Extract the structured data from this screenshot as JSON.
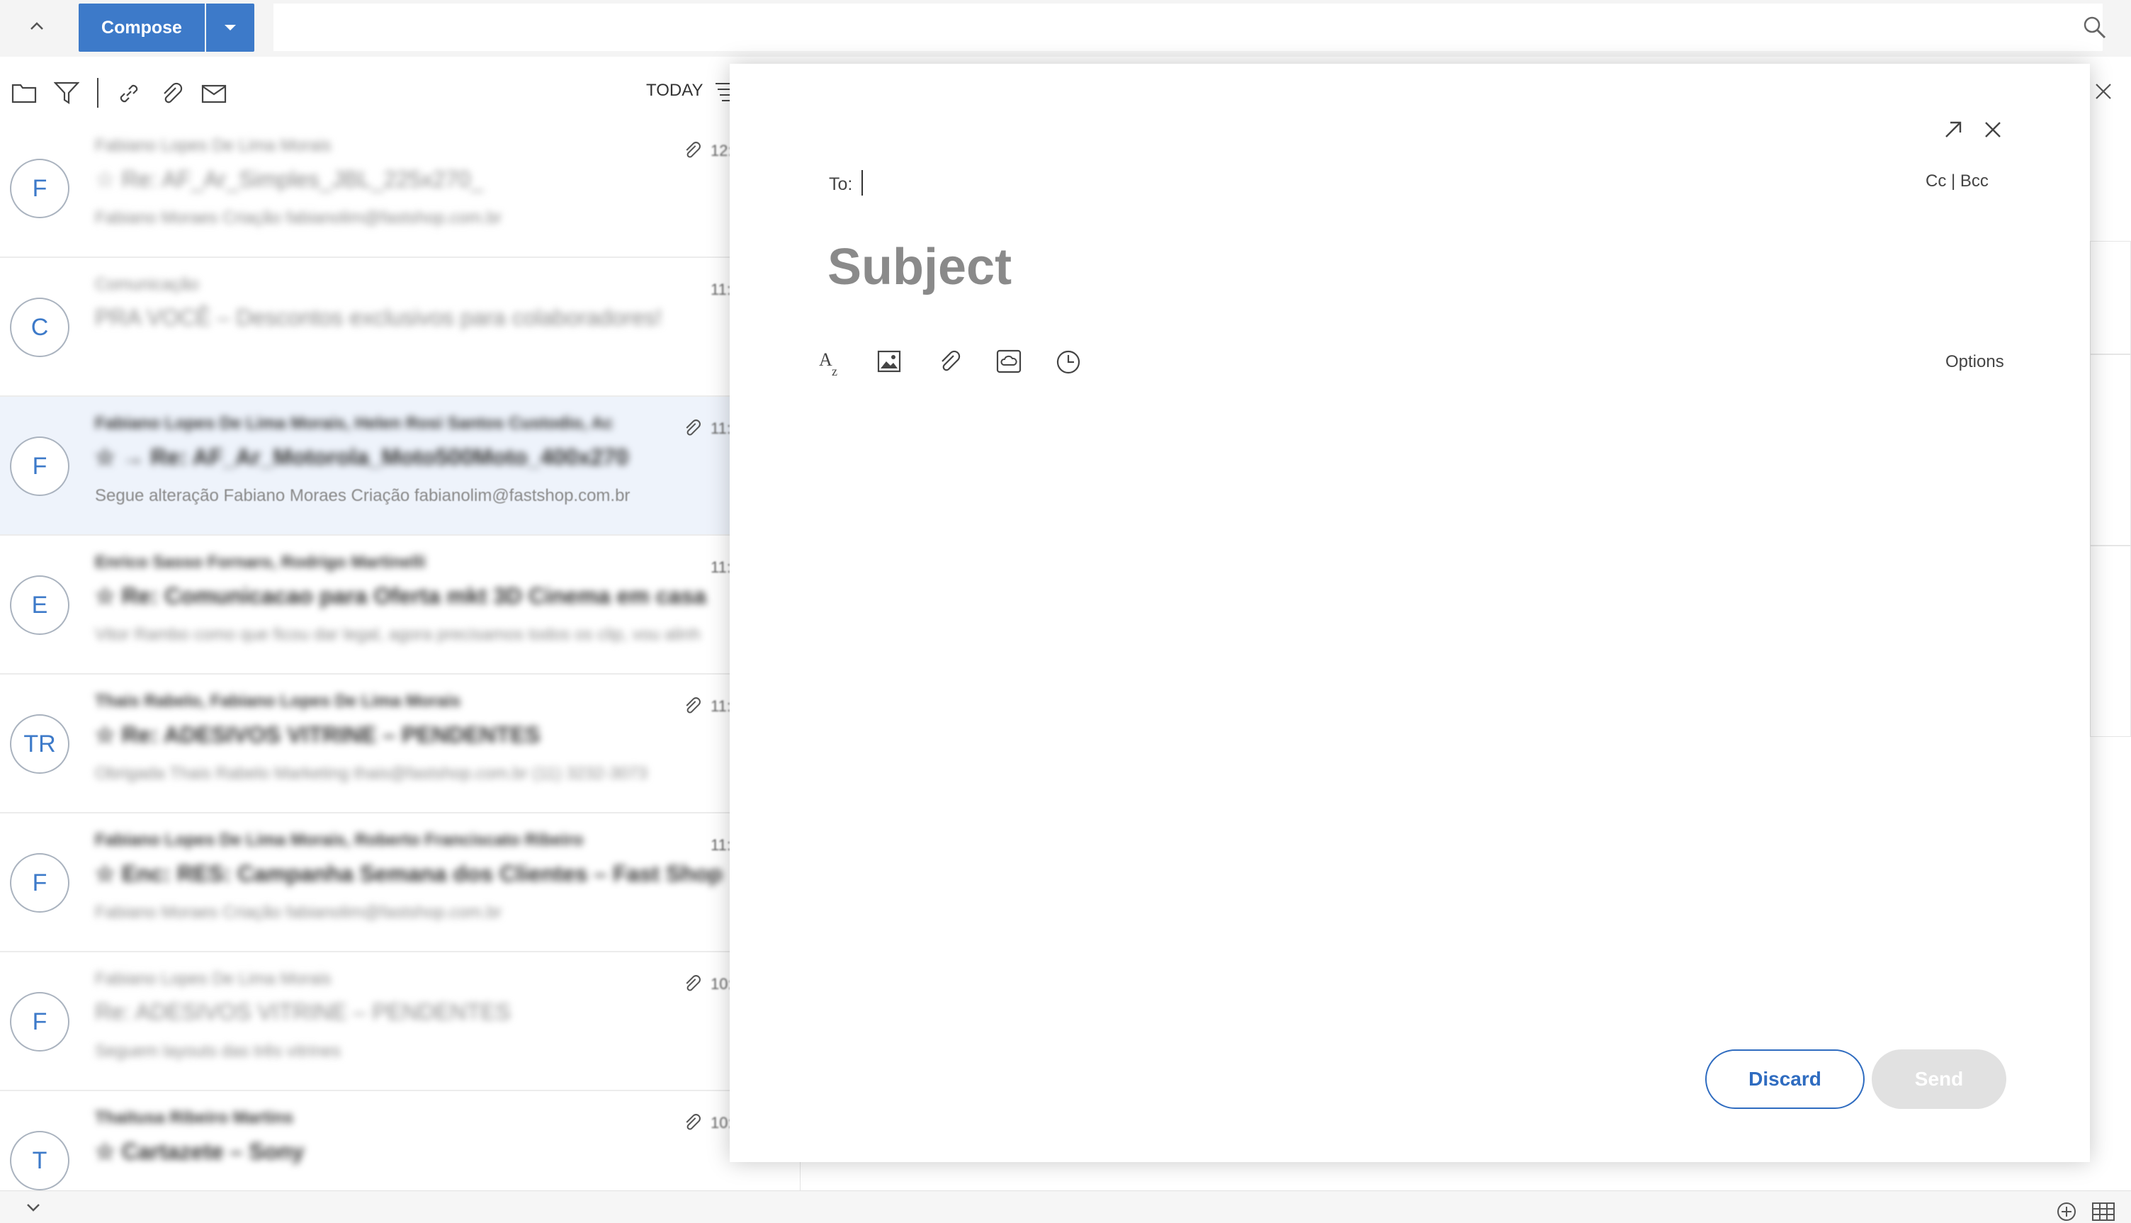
{
  "toolbar": {
    "compose_label": "Compose",
    "search_placeholder": "",
    "sort_label": "TODAY"
  },
  "message_list": [
    {
      "initials": "F",
      "from": "Fabiano Lopes De Lima Morais",
      "subject": "☆ Re: AF_Ar_Simples_JBL_225x270_",
      "preview": "Fabiano Moraes Criação fabianolim@fastshop.com.br",
      "time": "12:",
      "has_attachment": true,
      "selected": false
    },
    {
      "initials": "C",
      "from": "Comunicação",
      "subject": "PRA VOCÊ – Descontos exclusivos para colaboradores!",
      "preview": "",
      "time": "11:",
      "has_attachment": false,
      "selected": false
    },
    {
      "initials": "F",
      "from": "Fabiano Lopes De Lima Morais, Helen Rosi Santos Custodio, Ac",
      "subject": "☆ → Re: AF_Ar_Motorola_Moto500Moto_400x270",
      "preview": "Segue alteração Fabiano Moraes Criação fabianolim@fastshop.com.br",
      "time": "11:",
      "has_attachment": true,
      "selected": true
    },
    {
      "initials": "E",
      "from": "Enrico Sasso Fornaro, Rodrigo Martinelli",
      "subject": "☆ Re: Comunicacao para Oferta mkt 3D Cinema em casa",
      "preview": "Vitor Rambo como que ficou dar legal, agora precisamos todos os clip, vou alinh",
      "time": "11:",
      "has_attachment": false,
      "selected": false
    },
    {
      "initials": "TR",
      "from": "Thais Rabelo, Fabiano Lopes De Lima Morais",
      "subject": "☆ Re: ADESIVOS VITRINE – PENDENTES",
      "preview": "Obrigada Thais Rabelo Marketing thais@fastshop.com.br (11) 3232-3073",
      "time": "11:",
      "has_attachment": true,
      "selected": false
    },
    {
      "initials": "F",
      "from": "Fabiano Lopes De Lima Morais, Roberto Franciscato Ribeiro",
      "subject": "☆ Enc: RES: Campanha Semana dos Clientes – Fast Shop",
      "preview": "Fabiano Moraes Criação fabianolim@fastshop.com.br",
      "time": "11:",
      "has_attachment": false,
      "selected": false
    },
    {
      "initials": "F",
      "from": "Fabiano Lopes De Lima Morais",
      "subject": "Re: ADESIVOS VITRINE – PENDENTES",
      "preview": "Seguem layouts das três vitrines",
      "time": "10:",
      "has_attachment": true,
      "selected": false
    },
    {
      "initials": "T",
      "from": "Thaitusa Ribeiro Martins",
      "subject": "☆ Cartazete – Sony",
      "preview": "",
      "time": "10:",
      "has_attachment": true,
      "selected": false
    }
  ],
  "compose_dialog": {
    "to_label": "To:",
    "cc_bcc_label": "Cc | Bcc",
    "subject_placeholder": "Subject",
    "options_label": "Options",
    "discard_label": "Discard",
    "send_label": "Send"
  },
  "colors": {
    "accent": "#3d7ac9",
    "selected_row": "#eef3fb",
    "send_disabled": "#e1e1e1"
  }
}
